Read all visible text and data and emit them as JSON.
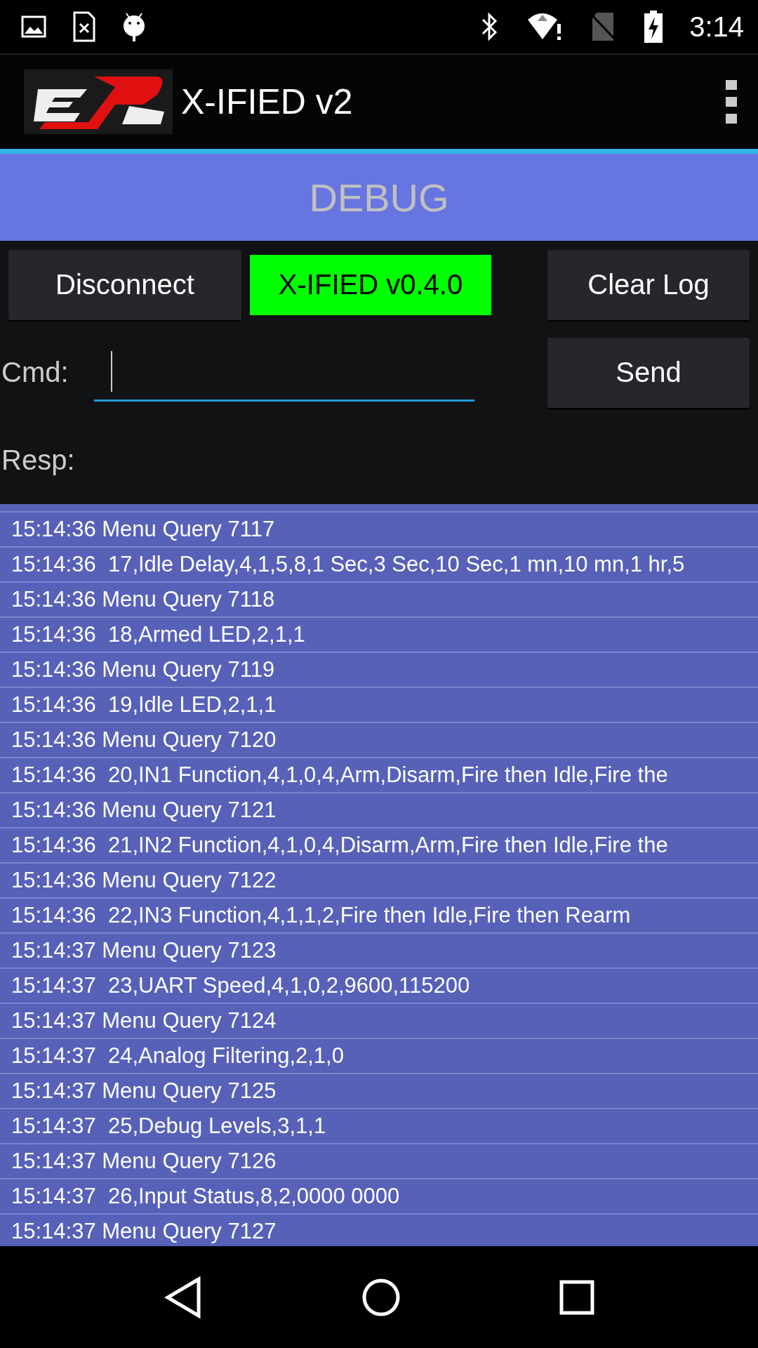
{
  "status_bar": {
    "time": "3:14"
  },
  "app_bar": {
    "title": "X-IFIED v2"
  },
  "section": {
    "title": "DEBUG"
  },
  "controls": {
    "disconnect": "Disconnect",
    "version": "X-IFIED v0.4.0",
    "clear": "Clear Log",
    "cmd_label": "Cmd:",
    "send": "Send",
    "resp_label": "Resp:"
  },
  "log": [
    "15:14:36 Menu Query 7117",
    "15:14:36  17,Idle Delay,4,1,5,8,1 Sec,3 Sec,10 Sec,1 mn,10 mn,1 hr,5",
    "15:14:36 Menu Query 7118",
    "15:14:36  18,Armed LED,2,1,1",
    "15:14:36 Menu Query 7119",
    "15:14:36  19,Idle LED,2,1,1",
    "15:14:36 Menu Query 7120",
    "15:14:36  20,IN1 Function,4,1,0,4,Arm,Disarm,Fire then Idle,Fire the",
    "15:14:36 Menu Query 7121",
    "15:14:36  21,IN2 Function,4,1,0,4,Disarm,Arm,Fire then Idle,Fire the",
    "15:14:36 Menu Query 7122",
    "15:14:36  22,IN3 Function,4,1,1,2,Fire then Idle,Fire then Rearm",
    "15:14:37 Menu Query 7123",
    "15:14:37  23,UART Speed,4,1,0,2,9600,115200",
    "15:14:37 Menu Query 7124",
    "15:14:37  24,Analog Filtering,2,1,0",
    "15:14:37 Menu Query 7125",
    "15:14:37  25,Debug Levels,3,1,1",
    "15:14:37 Menu Query 7126",
    "15:14:37  26,Input Status,8,2,0000 0000",
    "15:14:37 Menu Query 7127"
  ]
}
